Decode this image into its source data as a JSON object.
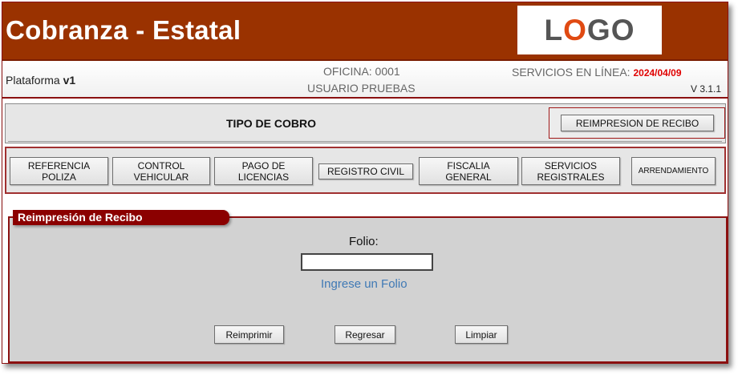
{
  "header": {
    "title": "Cobranza - Estatal",
    "logo": {
      "l": "L",
      "o": "O",
      "g": "G",
      "o2": "O"
    }
  },
  "infobar": {
    "platform_label": "Plataforma ",
    "platform_version": "v1",
    "office": "OFICINA: 0001",
    "user": "USUARIO PRUEBAS",
    "services_label": "SERVICIOS EN LÍNEA: ",
    "services_date": "2024/04/09",
    "app_version": "V 3.1.1"
  },
  "tipo": {
    "title": "TIPO DE COBRO",
    "reprint_button": "REIMPRESION DE RECIBO"
  },
  "categories": [
    {
      "line1": "REFERENCIA",
      "line2": "POLIZA"
    },
    {
      "line1": "CONTROL",
      "line2": "VEHICULAR"
    },
    {
      "line1": "PAGO DE",
      "line2": "LICENCIAS"
    },
    {
      "line1": "REGISTRO CIVIL",
      "line2": ""
    },
    {
      "line1": "FISCALIA",
      "line2": "GENERAL"
    },
    {
      "line1": "SERVICIOS",
      "line2": "REGISTRALES"
    },
    {
      "line1": "ARRENDAMIENTO",
      "line2": ""
    }
  ],
  "reprint_section": {
    "title": "Reimpresión de Recibo",
    "folio_label": "Folio:",
    "folio_value": "",
    "folio_hint": "Ingrese un Folio",
    "buttons": {
      "reprint": "Reimprimir",
      "back": "Regresar",
      "clear": "Limpiar"
    }
  },
  "colors": {
    "header_bg": "#9a3200",
    "accent": "#8b0000",
    "date_red": "#e00000",
    "hint_blue": "#3f79b5"
  }
}
